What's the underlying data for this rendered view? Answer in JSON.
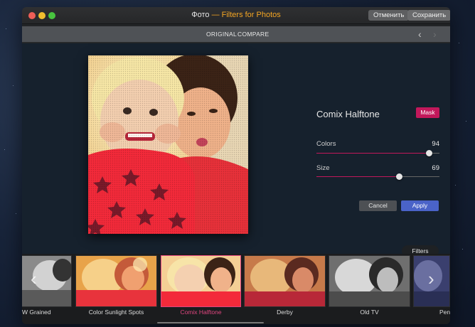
{
  "window": {
    "title_app": "Фото",
    "title_ext": "— Filters for Photos",
    "cancel_label": "Отменить",
    "save_label": "Сохранить"
  },
  "subbar": {
    "original_label": "ORIGINAL",
    "compare_label": "COMPARE"
  },
  "panel": {
    "filter_name": "Comix Halftone",
    "mask_label": "Mask",
    "sliders": [
      {
        "label": "Colors",
        "value": "94"
      },
      {
        "label": "Size",
        "value": "69"
      }
    ],
    "cancel_label": "Cancel",
    "apply_label": "Apply",
    "filters_label": "Filters"
  },
  "filters": [
    {
      "label": "W Grained",
      "selected": false
    },
    {
      "label": "Color Sunlight Spots",
      "selected": false
    },
    {
      "label": "Comix Halftone",
      "selected": true
    },
    {
      "label": "Derby",
      "selected": false
    },
    {
      "label": "Old TV",
      "selected": false
    },
    {
      "label": "Pen",
      "selected": false
    }
  ],
  "colors": {
    "accent": "#c2185b",
    "apply": "#4a63c8",
    "title_ext": "#f5a623"
  }
}
